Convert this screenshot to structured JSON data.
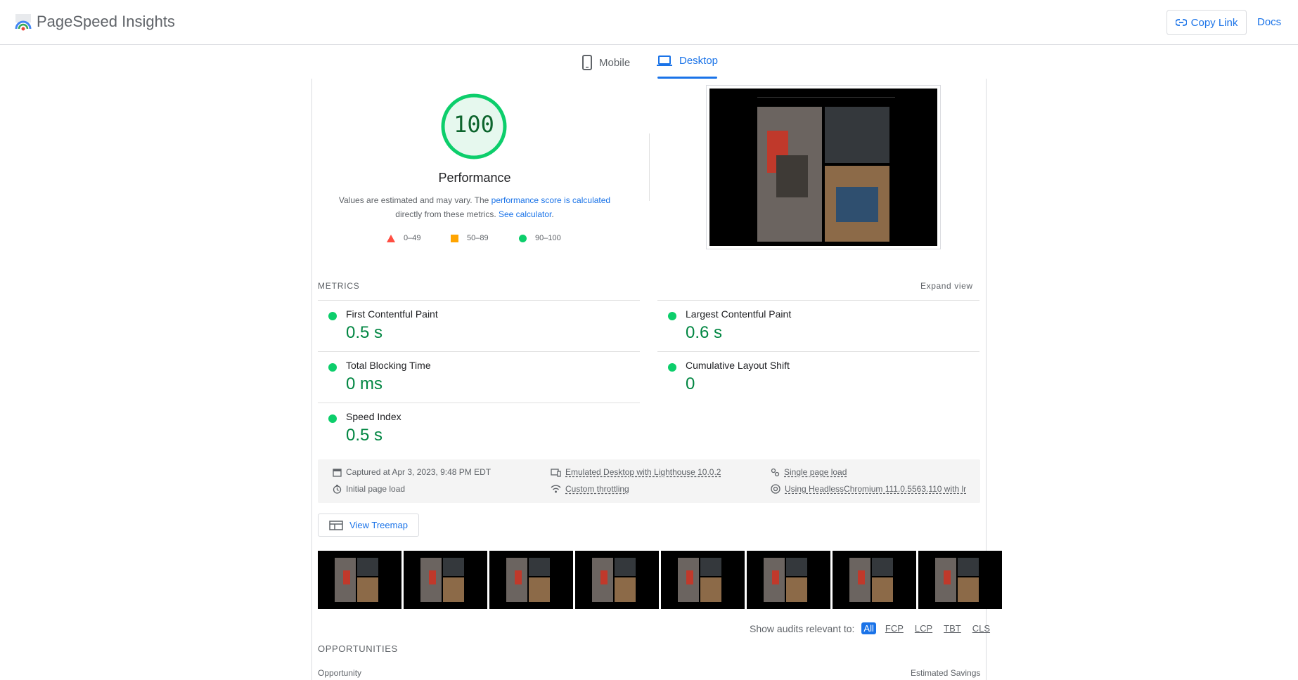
{
  "header": {
    "brand": "PageSpeed Insights",
    "copy_link": "Copy Link",
    "docs": "Docs",
    "logo_icon": "pagespeed-logo-icon",
    "link_icon": "link-icon"
  },
  "tabs": [
    {
      "label": "Mobile",
      "icon": "phone-icon",
      "selected": false
    },
    {
      "label": "Desktop",
      "icon": "laptop-icon",
      "selected": true
    }
  ],
  "score": {
    "value": "100",
    "category": "Performance",
    "desc_prefix": "Values are estimated and may vary. The ",
    "desc_link1": "performance score is calculated",
    "desc_middle": "directly from these metrics. ",
    "desc_link2": "See calculator",
    "desc_suffix": ".",
    "color": "#0cce6b",
    "fraction": 1.0
  },
  "legend": [
    {
      "range": "0–49",
      "shape": "triangle",
      "color": "#ff4e42"
    },
    {
      "range": "50–89",
      "shape": "square",
      "color": "#ffa400"
    },
    {
      "range": "90–100",
      "shape": "circle",
      "color": "#0cce6b"
    }
  ],
  "metrics": {
    "label": "METRICS",
    "expand": "Expand view",
    "items": [
      {
        "name": "First Contentful Paint",
        "value": "0.5 s"
      },
      {
        "name": "Largest Contentful Paint",
        "value": "0.6 s"
      },
      {
        "name": "Total Blocking Time",
        "value": "0 ms"
      },
      {
        "name": "Cumulative Layout Shift",
        "value": "0"
      },
      {
        "name": "Speed Index",
        "value": "0.5 s"
      }
    ]
  },
  "info": {
    "captured": "Captured at Apr 3, 2023, 9:48 PM EDT",
    "initial": "Initial page load",
    "emulated": "Emulated Desktop with Lighthouse 10.0.2",
    "throttling": "Custom throttling",
    "single": "Single page load",
    "browser": "Using HeadlessChromium 111.0.5563.110 with lr"
  },
  "treemap": "View Treemap",
  "audits": {
    "label": "Show audits relevant to:",
    "filters": [
      "All",
      "FCP",
      "LCP",
      "TBT",
      "CLS"
    ],
    "active": "All"
  },
  "opportunities": {
    "title": "OPPORTUNITIES",
    "col_left": "Opportunity",
    "col_right": "Estimated Savings"
  }
}
